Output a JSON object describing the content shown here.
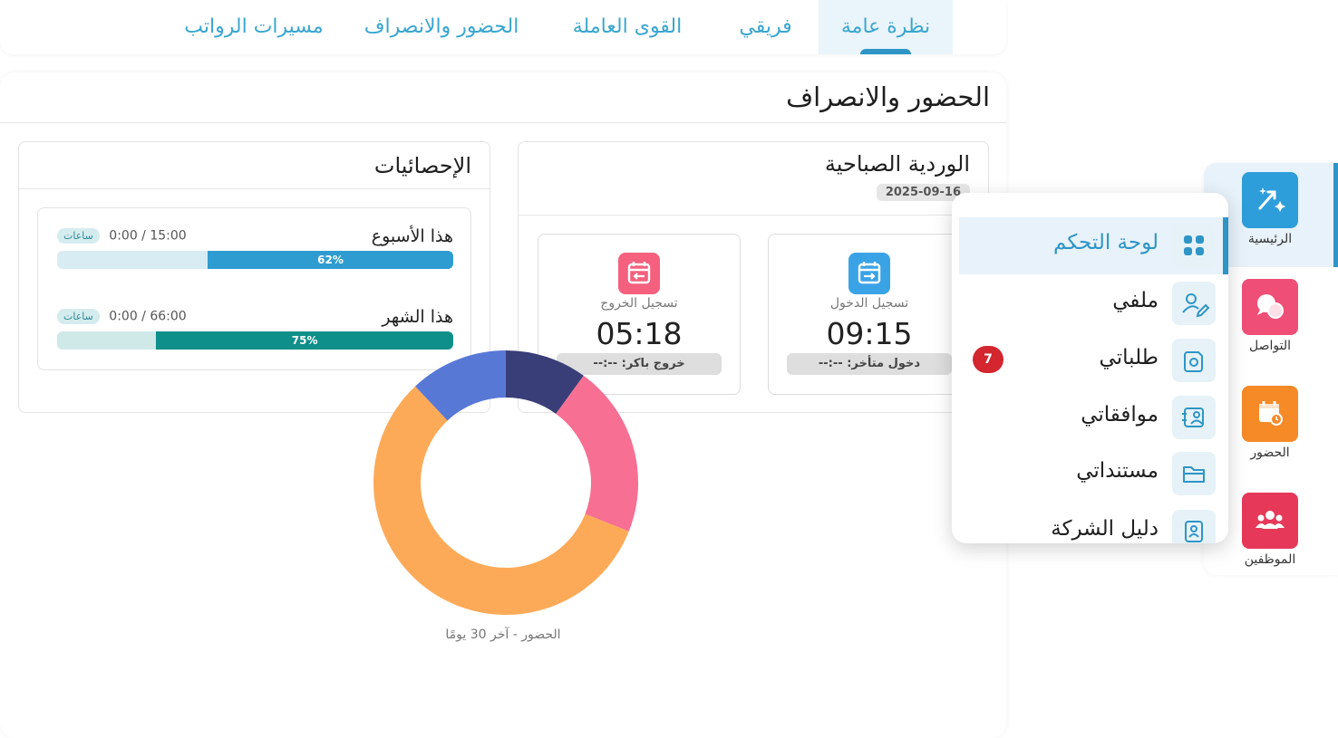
{
  "tabs": [
    {
      "label": "نظرة عامة",
      "active": true
    },
    {
      "label": "فريقي",
      "active": false
    },
    {
      "label": "القوى العاملة",
      "active": false
    },
    {
      "label": "الحضور والانصراف",
      "active": false
    },
    {
      "label": "مسيرات الرواتب",
      "active": false
    }
  ],
  "page_title": "الحضور والانصراف",
  "shift": {
    "title": "الوردية الصباحية",
    "date": "2025-09-16",
    "check_in": {
      "label": "تسجيل الدخول",
      "time": "09:15",
      "note": "دخول متأخر: --:--",
      "icon": "calendar-arrow-in-icon",
      "color": "#3aa3e6"
    },
    "check_out": {
      "label": "تسجيل الخروج",
      "time": "05:18",
      "note": "خروج باكر: --:--",
      "icon": "calendar-arrow-out-icon",
      "color": "#f4607e"
    }
  },
  "stats": {
    "title": "الإحصائيات",
    "week": {
      "name": "هذا الأسبوع",
      "value": "0:00 / 15:00",
      "unit": "ساعات",
      "percent_label": "62%",
      "percent": 62,
      "color": "#2e9cd0",
      "track": "#d8ecf4"
    },
    "month": {
      "name": "هذا الشهر",
      "value": "0:00 / 66:00",
      "unit": "ساعات",
      "percent_label": "75%",
      "percent": 75,
      "color": "#0f8f8a",
      "track": "#cfe8e8"
    }
  },
  "donut": {
    "caption": "الحضور - آخر 30 يومًا",
    "segments": [
      {
        "value": 10,
        "color": "#3a3e78"
      },
      {
        "value": 21,
        "color": "#f76f92"
      },
      {
        "value": 57,
        "color": "#fdaa58"
      },
      {
        "value": 12,
        "color": "#5878d6"
      }
    ]
  },
  "rail": [
    {
      "label": "الرئيسية",
      "icon": "home-sparkle-icon",
      "color": "#2e9edb",
      "active": true
    },
    {
      "label": "التواصل",
      "icon": "chat-bubbles-icon",
      "color": "#ef4f77",
      "active": false
    },
    {
      "label": "الحضور",
      "icon": "calendar-clock-icon",
      "color": "#f58a27",
      "active": false
    },
    {
      "label": "الموظفين",
      "icon": "users-icon",
      "color": "#e6395a",
      "active": false
    }
  ],
  "menu": [
    {
      "label": "لوحة التحكم",
      "icon": "dashboard-grid-icon",
      "active": true
    },
    {
      "label": "ملفي",
      "icon": "user-edit-icon",
      "active": false
    },
    {
      "label": "طلباتي",
      "icon": "request-doc-icon",
      "active": false
    },
    {
      "label": "موافقاتي",
      "icon": "approval-icon",
      "active": false
    },
    {
      "label": "مستنداتي",
      "icon": "folder-icon",
      "active": false
    },
    {
      "label": "دليل الشركة",
      "icon": "contact-book-icon",
      "active": false
    }
  ],
  "requests_badge": "7"
}
